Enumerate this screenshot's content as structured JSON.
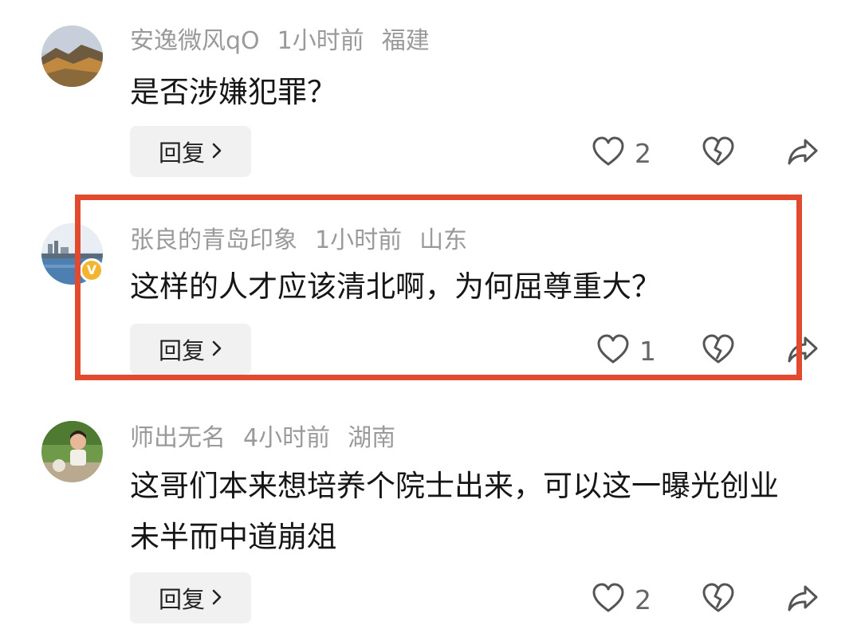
{
  "comments": [
    {
      "username": "安逸微风qO",
      "time": "1小时前",
      "location": "福建",
      "text": "是否涉嫌犯罪？",
      "reply_label": "回复",
      "likes": "2",
      "avatar": "mountain-landscape",
      "verified": false
    },
    {
      "username": "张良的青岛印象",
      "time": "1小时前",
      "location": "山东",
      "text": "这样的人才应该清北啊，为何屈尊重大？",
      "reply_label": "回复",
      "likes": "1",
      "avatar": "seaside-city",
      "verified": true,
      "verified_badge": "V",
      "highlighted": true,
      "highlight_color": "#e24a2f"
    },
    {
      "username": "师出无名",
      "time": "4小时前",
      "location": "湖南",
      "text": "这哥们本来想培养个院士出来，可以这一曝光创业未半而中道崩俎",
      "reply_label": "回复",
      "likes": "2",
      "avatar": "child-photo",
      "verified": false
    }
  ],
  "icons": {
    "like": "heart-outline-icon",
    "dislike": "broken-heart-icon",
    "share": "share-arrow-icon",
    "reply_chevron": "chevron-right-icon"
  }
}
